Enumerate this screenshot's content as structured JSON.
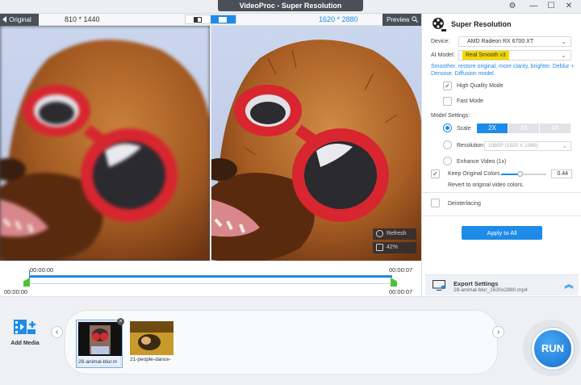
{
  "window": {
    "title": "VideoProc  -  Super Resolution",
    "settings_glyph": "⚙",
    "minimize_glyph": "—",
    "maximize_glyph": "☐",
    "close_glyph": "✕"
  },
  "preview": {
    "original_label": "Original",
    "preview_label": "Preview",
    "original_resolution": "810 * 1440",
    "output_resolution": "1620 * 2880",
    "compare_modes": [
      "split",
      "side-by-side"
    ],
    "active_compare_mode": "side-by-side",
    "refresh_label": "Refresh",
    "zoom_label": "42%"
  },
  "timeline": {
    "current_time": "00:00:00",
    "start_time": "00:00:00",
    "end_marker_time": "00:00:07",
    "end_time": "00:00:07"
  },
  "panel": {
    "title": "Super Resolution",
    "device_label": "Device:",
    "device_value": "AMD Radeon RX 6700 XT",
    "ai_model_label": "AI Model:",
    "ai_model_value": "Real Smooth v3",
    "description": "Smoother, restore original, more clarity, brighter. Deblur + Denoise. Diffusion model.",
    "high_quality_label": "High Quality Mode",
    "high_quality_checked": true,
    "fast_mode_label": "Fast Mode",
    "fast_mode_checked": false,
    "model_settings_label": "Model Settings:",
    "scale_label": "Scale",
    "scale_options": [
      "2X",
      "3X",
      "4X"
    ],
    "scale_selected": "2X",
    "resolution_label": "Resolution",
    "resolution_value": "1080P (1920 X 1080)",
    "enhance_label": "Enhance Video (1x)",
    "keep_colors_label": "Keep Original Colors",
    "keep_colors_checked": true,
    "keep_colors_value": "0.44",
    "revert_label": "Revert to original video colors.",
    "deinterlacing_label": "Deinterlacing",
    "deinterlacing_checked": false,
    "apply_all_label": "Apply to All",
    "export_title": "Export Settings",
    "export_file": "28-animal-blur_1620x2880.mp4",
    "check_glyph": "✓",
    "chevron_glyph": "⌄",
    "up_chevron_glyph": "︽"
  },
  "media": {
    "add_media_label": "Add Media",
    "prev_glyph": "‹",
    "next_glyph": "›",
    "close_glyph": "×",
    "items": [
      {
        "name": "28-animal-blur.m",
        "selected": true
      },
      {
        "name": "21-people-dance-",
        "selected": false
      }
    ],
    "run_label": "RUN"
  },
  "colors": {
    "accent": "#1e8be8",
    "highlight_chip": "#f5d700",
    "trim_handle": "#4fbf3a",
    "dark_tag": "#4a4f58"
  }
}
